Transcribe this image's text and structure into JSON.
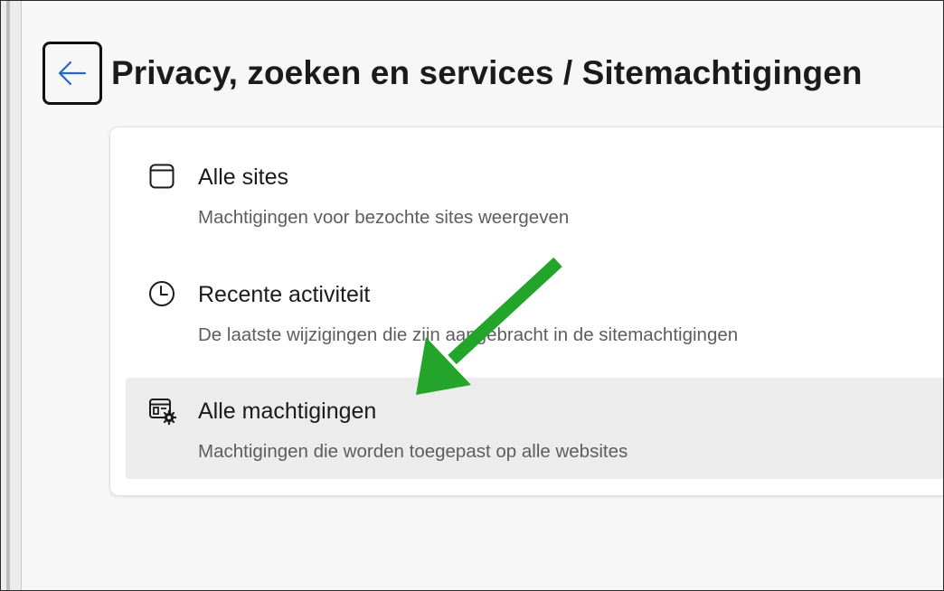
{
  "header": {
    "back_icon": "arrow-left-icon",
    "title": "Privacy, zoeken en services / Sitemachtigingen"
  },
  "permissions": {
    "items": [
      {
        "icon": "browser-window-icon",
        "title": "Alle sites",
        "description": "Machtigingen voor bezochte sites weergeven",
        "selected": false
      },
      {
        "icon": "clock-icon",
        "title": "Recente activiteit",
        "description": "De laatste wijzigingen die zijn aangebracht in de sitemachtigingen",
        "selected": false
      },
      {
        "icon": "window-settings-icon",
        "title": "Alle machtigingen",
        "description": "Machtigingen die worden toegepast op alle websites",
        "selected": true
      }
    ]
  },
  "annotation": {
    "icon": "green-pointer-arrow",
    "color": "#22a52a"
  },
  "colors": {
    "accent": "#2a63c9",
    "hover_row": "#ececec",
    "card": "#ffffff",
    "background": "#f7f7f7"
  }
}
